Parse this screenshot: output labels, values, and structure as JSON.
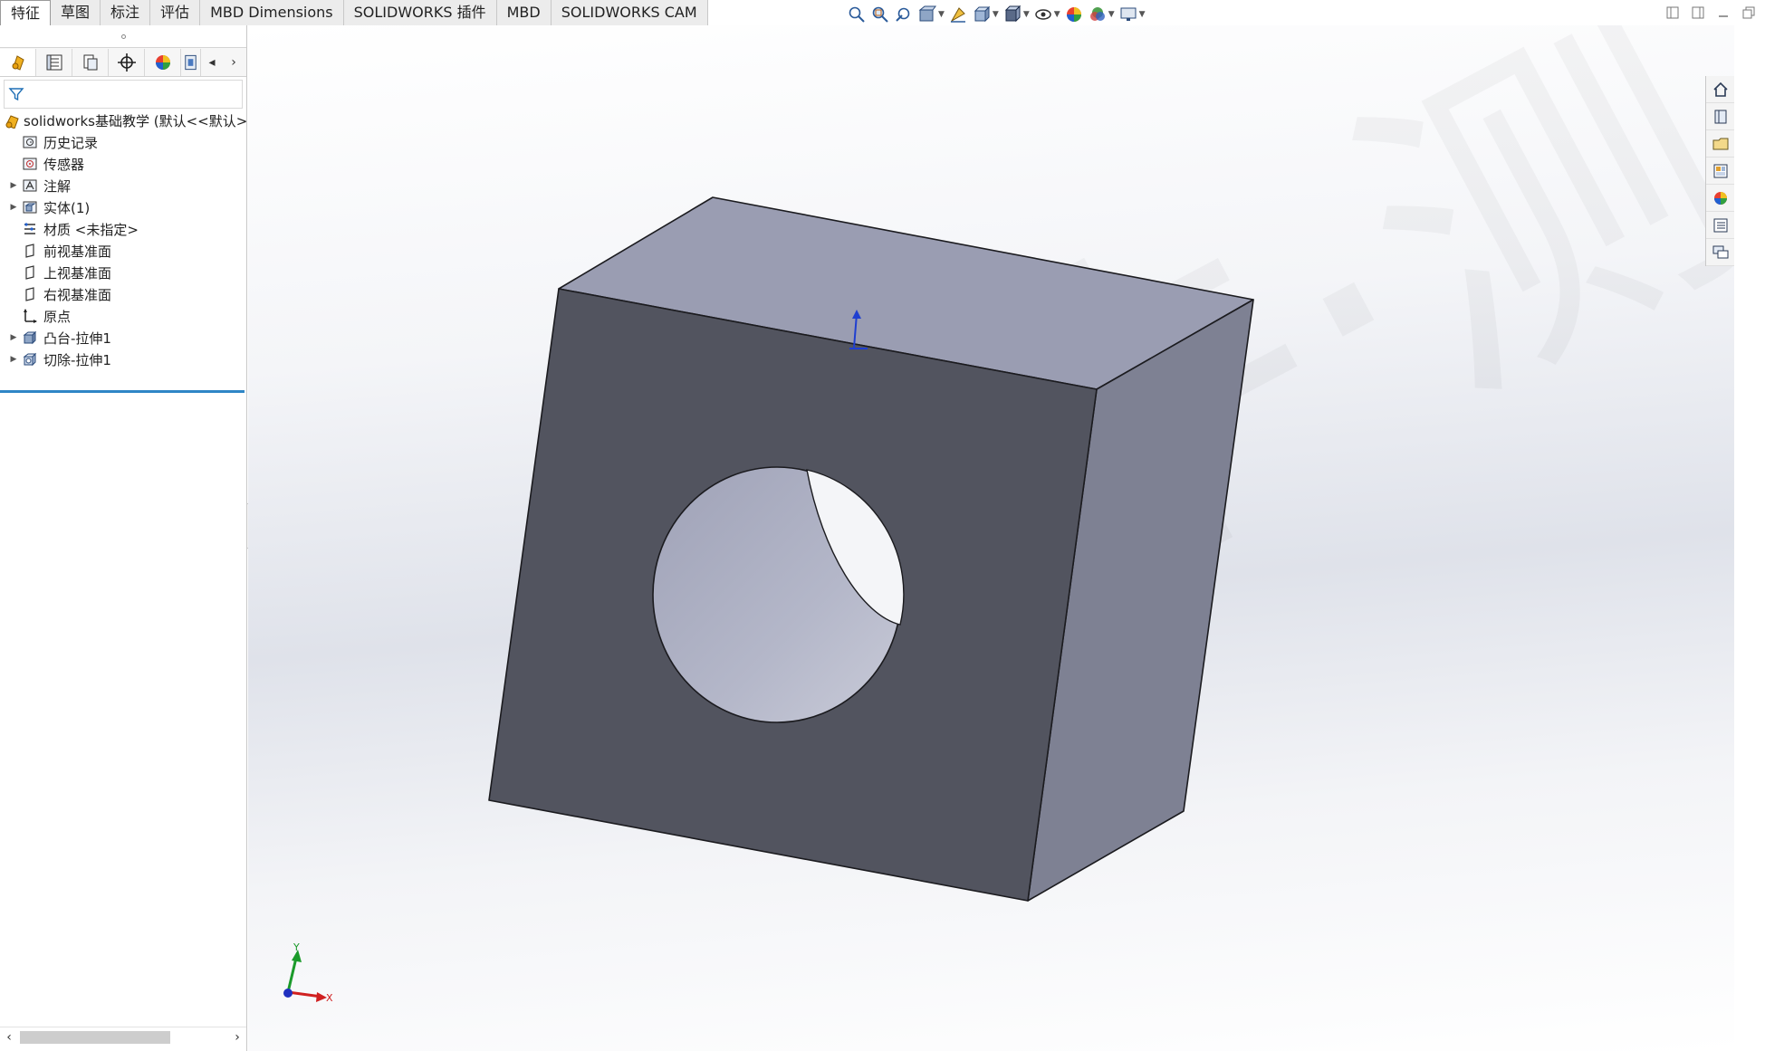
{
  "command_tabs": [
    {
      "label": "特征",
      "active": true
    },
    {
      "label": "草图",
      "active": false
    },
    {
      "label": "标注",
      "active": false
    },
    {
      "label": "评估",
      "active": false
    },
    {
      "label": "MBD Dimensions",
      "active": false
    },
    {
      "label": "SOLIDWORKS 插件",
      "active": false
    },
    {
      "label": "MBD",
      "active": false
    },
    {
      "label": "SOLIDWORKS CAM",
      "active": false
    }
  ],
  "hud_toolbar": {
    "icons": [
      "zoom-to-fit-icon",
      "zoom-to-area-icon",
      "previous-view-icon",
      "section-view-icon",
      "dynamic-annotation-icon",
      "view-orientation-icon",
      "display-style-icon",
      "hide-show-icon",
      "edit-appearance-icon",
      "apply-scene-icon",
      "view-settings-icon"
    ]
  },
  "feature_manager": {
    "tabs": [
      "feature-manager-icon",
      "property-manager-icon",
      "configuration-manager-icon",
      "dimxpert-icon",
      "display-manager-icon",
      "cam-manager-icon"
    ],
    "tree": [
      {
        "label": "solidworks基础教学  (默认<<默认>",
        "icon": "part-icon",
        "expandable": false,
        "kind": "root"
      },
      {
        "label": "历史记录",
        "icon": "history-icon",
        "expandable": false,
        "kind": "leaf"
      },
      {
        "label": "传感器",
        "icon": "sensor-icon",
        "expandable": false,
        "kind": "leaf"
      },
      {
        "label": "注解",
        "icon": "annotation-icon",
        "expandable": true,
        "kind": "child"
      },
      {
        "label": "实体(1)",
        "icon": "solid-body-icon",
        "expandable": true,
        "kind": "child"
      },
      {
        "label": "材质 <未指定>",
        "icon": "material-icon",
        "expandable": false,
        "kind": "leaf"
      },
      {
        "label": "前视基准面",
        "icon": "plane-icon",
        "expandable": false,
        "kind": "leaf"
      },
      {
        "label": "上视基准面",
        "icon": "plane-icon",
        "expandable": false,
        "kind": "leaf"
      },
      {
        "label": "右视基准面",
        "icon": "plane-icon",
        "expandable": false,
        "kind": "leaf"
      },
      {
        "label": "原点",
        "icon": "origin-icon",
        "expandable": false,
        "kind": "leaf"
      },
      {
        "label": "凸台-拉伸1",
        "icon": "boss-extrude-icon",
        "expandable": true,
        "kind": "child"
      },
      {
        "label": "切除-拉伸1",
        "icon": "cut-extrude-icon",
        "expandable": true,
        "kind": "child"
      }
    ]
  },
  "viewport": {
    "model": "block-with-through-hole",
    "watermark": "大·牛·测·绘",
    "triad": {
      "x": "X",
      "y": "Y"
    }
  },
  "task_pane": {
    "icons": [
      "home-icon",
      "design-library-icon",
      "file-explorer-icon",
      "view-palette-icon",
      "appearances-icon",
      "custom-properties-icon",
      "forum-icon"
    ]
  },
  "colors": {
    "front_face": "#52545f",
    "top_face": "#9a9db2",
    "right_face": "#7e8193",
    "hole_bore": "#aeb1c4",
    "active_tab_border": "#9a9a9a",
    "rollback_bar": "#2f86c6"
  }
}
